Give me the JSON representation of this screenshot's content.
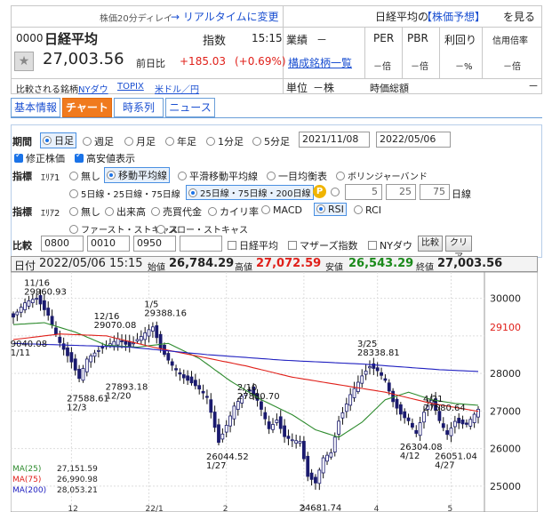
{
  "header": {
    "delay_note": "株価20分ディレイ",
    "realtime_link": "→ リアルタイムに変更",
    "right_title": "日経平均の",
    "forecast_link": "【株価予想】",
    "see_label": "を見る",
    "code": "0000",
    "name": "日経平均",
    "index_label": "指数",
    "time": "15:15",
    "industry_label": "業績",
    "industry_value": "－",
    "price": "27,003.56",
    "prev_label": "前日比",
    "change": "+185.03",
    "change_pct": "(+0.69%)",
    "constituents_link": "構成銘柄一覧",
    "unit_label": "単位",
    "unit_value": "－株",
    "compare_label": "比較される銘柄",
    "compare_links": [
      "NYダウ",
      "TOPIX",
      "米ドル／円"
    ],
    "metrics": [
      {
        "label": "PER",
        "value": "－倍"
      },
      {
        "label": "PBR",
        "value": "－倍"
      },
      {
        "label": "利回り",
        "value": "－%"
      },
      {
        "label": "信用倍率",
        "value": "－倍"
      }
    ],
    "market_cap_label": "時価総額",
    "market_cap_value": "－"
  },
  "tabs": [
    "基本情報",
    "チャート",
    "時系列",
    "ニュース"
  ],
  "options": {
    "period_label": "期間",
    "periods": [
      "日足",
      "週足",
      "月足",
      "年足",
      "1分足",
      "5分足"
    ],
    "date_from": "2021/11/08",
    "date_to": "2022/05/06",
    "adjusted_label": "修正株価",
    "highlow_label": "高安値表示",
    "indicator_label": "指標",
    "area1_label": "ｴﾘｱ1",
    "area1_options": [
      "無し",
      "移動平均線",
      "平滑移動平均線",
      "一目均衡表",
      "ボリンジャーバンド"
    ],
    "ma_presets": [
      "5日線・25日線・75日線",
      "25日線・75日線・200日線"
    ],
    "ma_inputs": [
      "5",
      "25",
      "75"
    ],
    "ma_unit": "日線",
    "area2_label": "ｴﾘｱ2",
    "area2_options": [
      "無し",
      "出来高",
      "売買代金",
      "カイリ率",
      "MACD",
      "RSI",
      "RCI"
    ],
    "area2_options_row2": [
      "ファースト・ストキャス",
      "スロー・ストキャス"
    ],
    "compare_label": "比較",
    "compare_inputs": [
      "0800",
      "0010",
      "0950",
      ""
    ],
    "compare_checks": [
      "日経平均",
      "マザーズ指数",
      "NYダウ"
    ],
    "compare_button": "比較",
    "clear_button": "クリア"
  },
  "ohlc_bar": {
    "date_label": "日付",
    "date": "2022/05/06 15:15",
    "open_label": "始値",
    "open": "26,784.29",
    "high_label": "高値",
    "high": "27,072.59",
    "low_label": "安値",
    "low": "26,543.29",
    "close_label": "終値",
    "close": "27,003.56"
  },
  "chart_data": {
    "type": "line",
    "ylim": [
      24500,
      30700
    ],
    "yticks": [
      25000,
      26000,
      27000,
      28000,
      29000,
      30000
    ],
    "ytick_labels": [
      "25000",
      "26000",
      "27000",
      "28000",
      "",
      "30000"
    ],
    "current_price_label": "29100",
    "xtick_labels": [
      "12",
      "22/1",
      "2",
      "3",
      "4",
      "5"
    ],
    "xtick_index": [
      15,
      35,
      55,
      75,
      94,
      113
    ],
    "n_days": 121,
    "close_anchors": [
      [
        0,
        29500
      ],
      [
        3,
        29800
      ],
      [
        6,
        29950
      ],
      [
        9,
        29600
      ],
      [
        12,
        28900
      ],
      [
        15,
        28300
      ],
      [
        17,
        27800
      ],
      [
        19,
        28300
      ],
      [
        22,
        28600
      ],
      [
        24,
        28800
      ],
      [
        27,
        29000
      ],
      [
        30,
        28700
      ],
      [
        33,
        28900
      ],
      [
        36,
        29200
      ],
      [
        38,
        28700
      ],
      [
        41,
        28300
      ],
      [
        44,
        27900
      ],
      [
        47,
        27600
      ],
      [
        50,
        27300
      ],
      [
        53,
        26200
      ],
      [
        55,
        26700
      ],
      [
        57,
        27200
      ],
      [
        59,
        27400
      ],
      [
        61,
        27500
      ],
      [
        63,
        27200
      ],
      [
        66,
        26500
      ],
      [
        68,
        26800
      ],
      [
        70,
        26400
      ],
      [
        72,
        26300
      ],
      [
        74,
        26200
      ],
      [
        76,
        25200
      ],
      [
        78,
        25000
      ],
      [
        80,
        25700
      ],
      [
        82,
        25900
      ],
      [
        84,
        26800
      ],
      [
        87,
        27500
      ],
      [
        90,
        27900
      ],
      [
        92,
        28100
      ],
      [
        94,
        28000
      ],
      [
        96,
        27800
      ],
      [
        98,
        27300
      ],
      [
        100,
        27000
      ],
      [
        102,
        26800
      ],
      [
        104,
        26400
      ],
      [
        106,
        26900
      ],
      [
        108,
        27200
      ],
      [
        110,
        26700
      ],
      [
        112,
        26400
      ],
      [
        114,
        26800
      ],
      [
        117,
        26700
      ],
      [
        120,
        27003
      ]
    ],
    "annotations": [
      {
        "text": "11/16",
        "sub": "29960.93",
        "i": 6,
        "v": 29960
      },
      {
        "text": "29040.08",
        "sub": "11/11",
        "i": 1,
        "v": 29040
      },
      {
        "text": "12/16",
        "sub": "29070.08",
        "i": 24,
        "v": 29070
      },
      {
        "text": "1/5",
        "sub": "29388.16",
        "i": 37,
        "v": 29388
      },
      {
        "text": "27588.61",
        "sub": "12/3",
        "i": 17,
        "v": 27588
      },
      {
        "text": "27893.18",
        "sub": "12/20",
        "i": 27,
        "v": 27893
      },
      {
        "text": "2/10",
        "sub": "27880.70",
        "i": 61,
        "v": 27880
      },
      {
        "text": "26044.52",
        "sub": "1/27",
        "i": 53,
        "v": 26044
      },
      {
        "text": "3/25",
        "sub": "28338.81",
        "i": 92,
        "v": 28338
      },
      {
        "text": "4/21",
        "sub": "27580.64",
        "i": 109,
        "v": 27580
      },
      {
        "text": "26304.08",
        "sub": "4/12",
        "i": 103,
        "v": 26304
      },
      {
        "text": "26051.04",
        "sub": "4/27",
        "i": 112,
        "v": 26051
      },
      {
        "text": "24681.74",
        "sub": "3/9",
        "i": 77,
        "v": 24681
      }
    ],
    "series": [
      {
        "name": "MA(25)",
        "value": "27,151.59",
        "color": "#2e8b2e",
        "anchors": [
          [
            0,
            29300
          ],
          [
            8,
            29350
          ],
          [
            16,
            29100
          ],
          [
            24,
            28750
          ],
          [
            32,
            28700
          ],
          [
            40,
            28800
          ],
          [
            48,
            28400
          ],
          [
            56,
            27800
          ],
          [
            64,
            27300
          ],
          [
            72,
            26900
          ],
          [
            78,
            26500
          ],
          [
            84,
            26300
          ],
          [
            90,
            26700
          ],
          [
            96,
            27300
          ],
          [
            102,
            27500
          ],
          [
            108,
            27300
          ],
          [
            114,
            27200
          ],
          [
            120,
            27151
          ]
        ]
      },
      {
        "name": "MA(75)",
        "value": "26,990.98",
        "color": "#e0201a",
        "anchors": [
          [
            0,
            28900
          ],
          [
            12,
            29050
          ],
          [
            24,
            29000
          ],
          [
            36,
            28700
          ],
          [
            48,
            28450
          ],
          [
            60,
            28200
          ],
          [
            72,
            27900
          ],
          [
            84,
            27700
          ],
          [
            96,
            27500
          ],
          [
            108,
            27200
          ],
          [
            120,
            26991
          ]
        ]
      },
      {
        "name": "MA(200)",
        "value": "28,053.21",
        "color": "#2020c0",
        "anchors": [
          [
            0,
            28800
          ],
          [
            30,
            28700
          ],
          [
            50,
            28500
          ],
          [
            70,
            28350
          ],
          [
            90,
            28250
          ],
          [
            110,
            28100
          ],
          [
            120,
            28053
          ]
        ]
      }
    ]
  }
}
